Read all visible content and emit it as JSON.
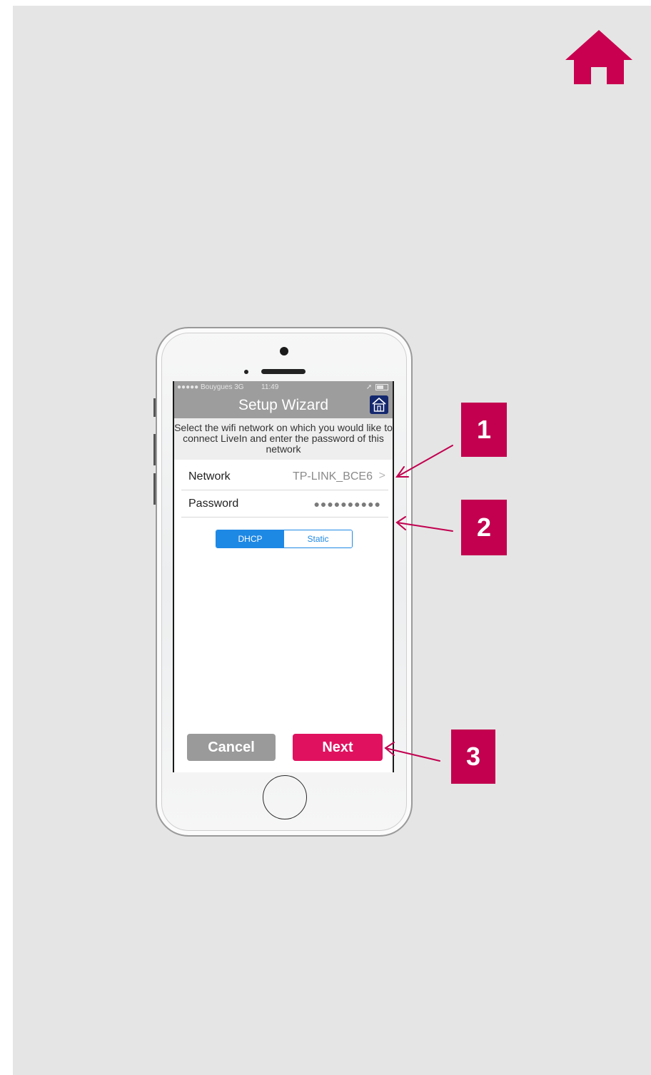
{
  "colors": {
    "background": "#e5e5e5",
    "accent": "#c2004f",
    "next_button": "#e0115f",
    "segment_active": "#1e88e5",
    "header": "#9d9d9d"
  },
  "top_home_icon": "home-icon",
  "phone": {
    "status_bar": {
      "carrier": "●●●●● Bouygues 3G",
      "time": "11:49"
    },
    "title": "Setup Wizard",
    "header_icon": "home-icon",
    "instructions": "Select the wifi network on which you would like to connect LiveIn and enter the password of this network",
    "network": {
      "label": "Network",
      "value": "TP-LINK_BCE6",
      "chevron": ">"
    },
    "password": {
      "label": "Password",
      "value": "●●●●●●●●●●"
    },
    "segments": {
      "dhcp": "DHCP",
      "static": "Static",
      "selected": "DHCP"
    },
    "cancel_label": "Cancel",
    "next_label": "Next"
  },
  "callouts": [
    {
      "label": "1"
    },
    {
      "label": "2"
    },
    {
      "label": "3"
    }
  ]
}
